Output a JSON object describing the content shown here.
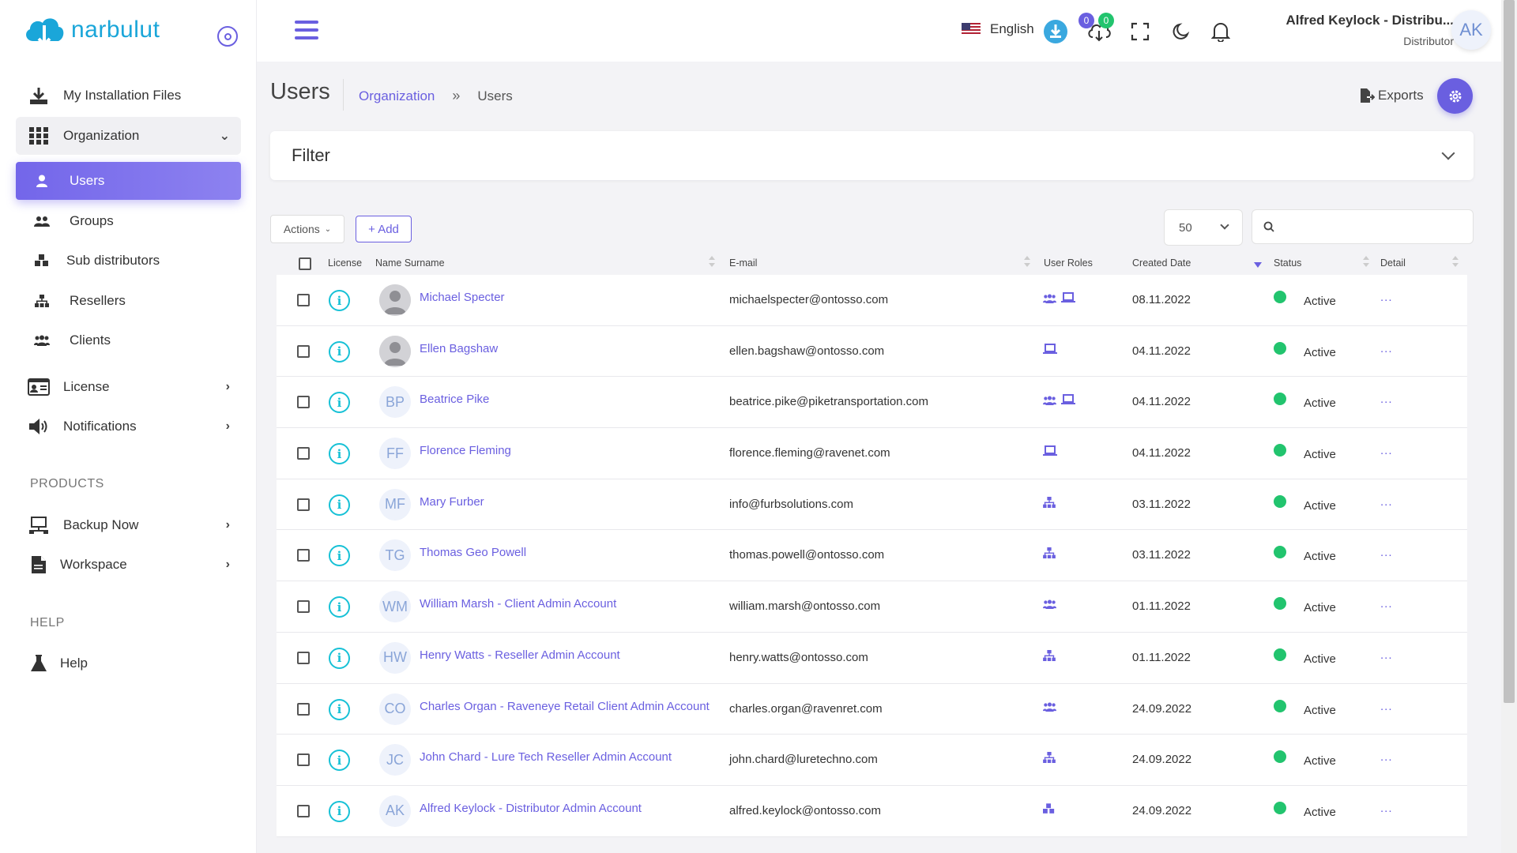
{
  "brand": {
    "name": "narbulut"
  },
  "sidebar": {
    "items": [
      {
        "label": "My Installation Files",
        "icon": "download-icon"
      },
      {
        "label": "Organization",
        "icon": "grid-icon"
      },
      {
        "label": "Users",
        "icon": "user-icon"
      },
      {
        "label": "Groups",
        "icon": "users-icon"
      },
      {
        "label": "Sub distributors",
        "icon": "cubes-icon"
      },
      {
        "label": "Resellers",
        "icon": "sitemap-icon"
      },
      {
        "label": "Clients",
        "icon": "users-icon"
      },
      {
        "label": "License",
        "icon": "id-card-icon"
      },
      {
        "label": "Notifications",
        "icon": "speaker-icon"
      }
    ],
    "products_heading": "PRODUCTS",
    "products": [
      {
        "label": "Backup Now",
        "icon": "network-icon"
      },
      {
        "label": "Workspace",
        "icon": "file-icon"
      }
    ],
    "help_heading": "HELP",
    "help": [
      {
        "label": "Help",
        "icon": "flask-icon"
      }
    ]
  },
  "topbar": {
    "language": "English",
    "badge_a": "0",
    "badge_b": "0",
    "user_name": "Alfred Keylock - Distribu...",
    "user_role": "Distributor",
    "avatar_initials": "AK"
  },
  "page": {
    "title": "Users",
    "breadcrumb": [
      "Organization",
      "Users"
    ],
    "exports_label": "Exports",
    "filter_title": "Filter",
    "actions_label": "Actions",
    "add_label": "+ Add",
    "per_page": "50",
    "search_placeholder": ""
  },
  "table": {
    "columns": [
      "License",
      "Name Surname",
      "E-mail",
      "User Roles",
      "Created Date",
      "Status",
      "Detail"
    ],
    "rows": [
      {
        "initials": "",
        "photo": true,
        "name": "Michael Specter",
        "email": "michaelspecter@ontosso.com",
        "roles": [
          "users",
          "laptop"
        ],
        "date": "08.11.2022",
        "status": "Active"
      },
      {
        "initials": "",
        "photo": true,
        "name": "Ellen Bagshaw",
        "email": "ellen.bagshaw@ontosso.com",
        "roles": [
          "laptop"
        ],
        "date": "04.11.2022",
        "status": "Active"
      },
      {
        "initials": "BP",
        "photo": false,
        "name": "Beatrice Pike",
        "email": "beatrice.pike@piketransportation.com",
        "roles": [
          "users",
          "laptop"
        ],
        "date": "04.11.2022",
        "status": "Active"
      },
      {
        "initials": "FF",
        "photo": false,
        "name": "Florence Fleming",
        "email": "florence.fleming@ravenet.com",
        "roles": [
          "laptop"
        ],
        "date": "04.11.2022",
        "status": "Active"
      },
      {
        "initials": "MF",
        "photo": false,
        "name": "Mary Furber",
        "email": "info@furbsolutions.com",
        "roles": [
          "sitemap"
        ],
        "date": "03.11.2022",
        "status": "Active"
      },
      {
        "initials": "TG",
        "photo": false,
        "name": "Thomas Geo Powell",
        "email": "thomas.powell@ontosso.com",
        "roles": [
          "sitemap"
        ],
        "date": "03.11.2022",
        "status": "Active"
      },
      {
        "initials": "WM",
        "photo": false,
        "name": "William Marsh - Client Admin Account",
        "email": "william.marsh@ontosso.com",
        "roles": [
          "users"
        ],
        "date": "01.11.2022",
        "status": "Active"
      },
      {
        "initials": "HW",
        "photo": false,
        "name": "Henry Watts - Reseller Admin Account",
        "email": "henry.watts@ontosso.com",
        "roles": [
          "sitemap"
        ],
        "date": "01.11.2022",
        "status": "Active"
      },
      {
        "initials": "CO",
        "photo": false,
        "name": "Charles Organ - Raveneye Retail Client Admin Account",
        "email": "charles.organ@ravenret.com",
        "roles": [
          "users"
        ],
        "date": "24.09.2022",
        "status": "Active"
      },
      {
        "initials": "JC",
        "photo": false,
        "name": "John Chard - Lure Tech Reseller Admin Account",
        "email": "john.chard@luretechno.com",
        "roles": [
          "sitemap"
        ],
        "date": "24.09.2022",
        "status": "Active"
      },
      {
        "initials": "AK",
        "photo": false,
        "name": "Alfred Keylock - Distributor Admin Account",
        "email": "alfred.keylock@ontosso.com",
        "roles": [
          "cubes"
        ],
        "date": "24.09.2022",
        "status": "Active"
      }
    ],
    "detail_label": "..."
  },
  "colors": {
    "accent": "#6a5fe0",
    "brand": "#1aa6d9",
    "info": "#17c1d6",
    "active": "#22c46e"
  }
}
